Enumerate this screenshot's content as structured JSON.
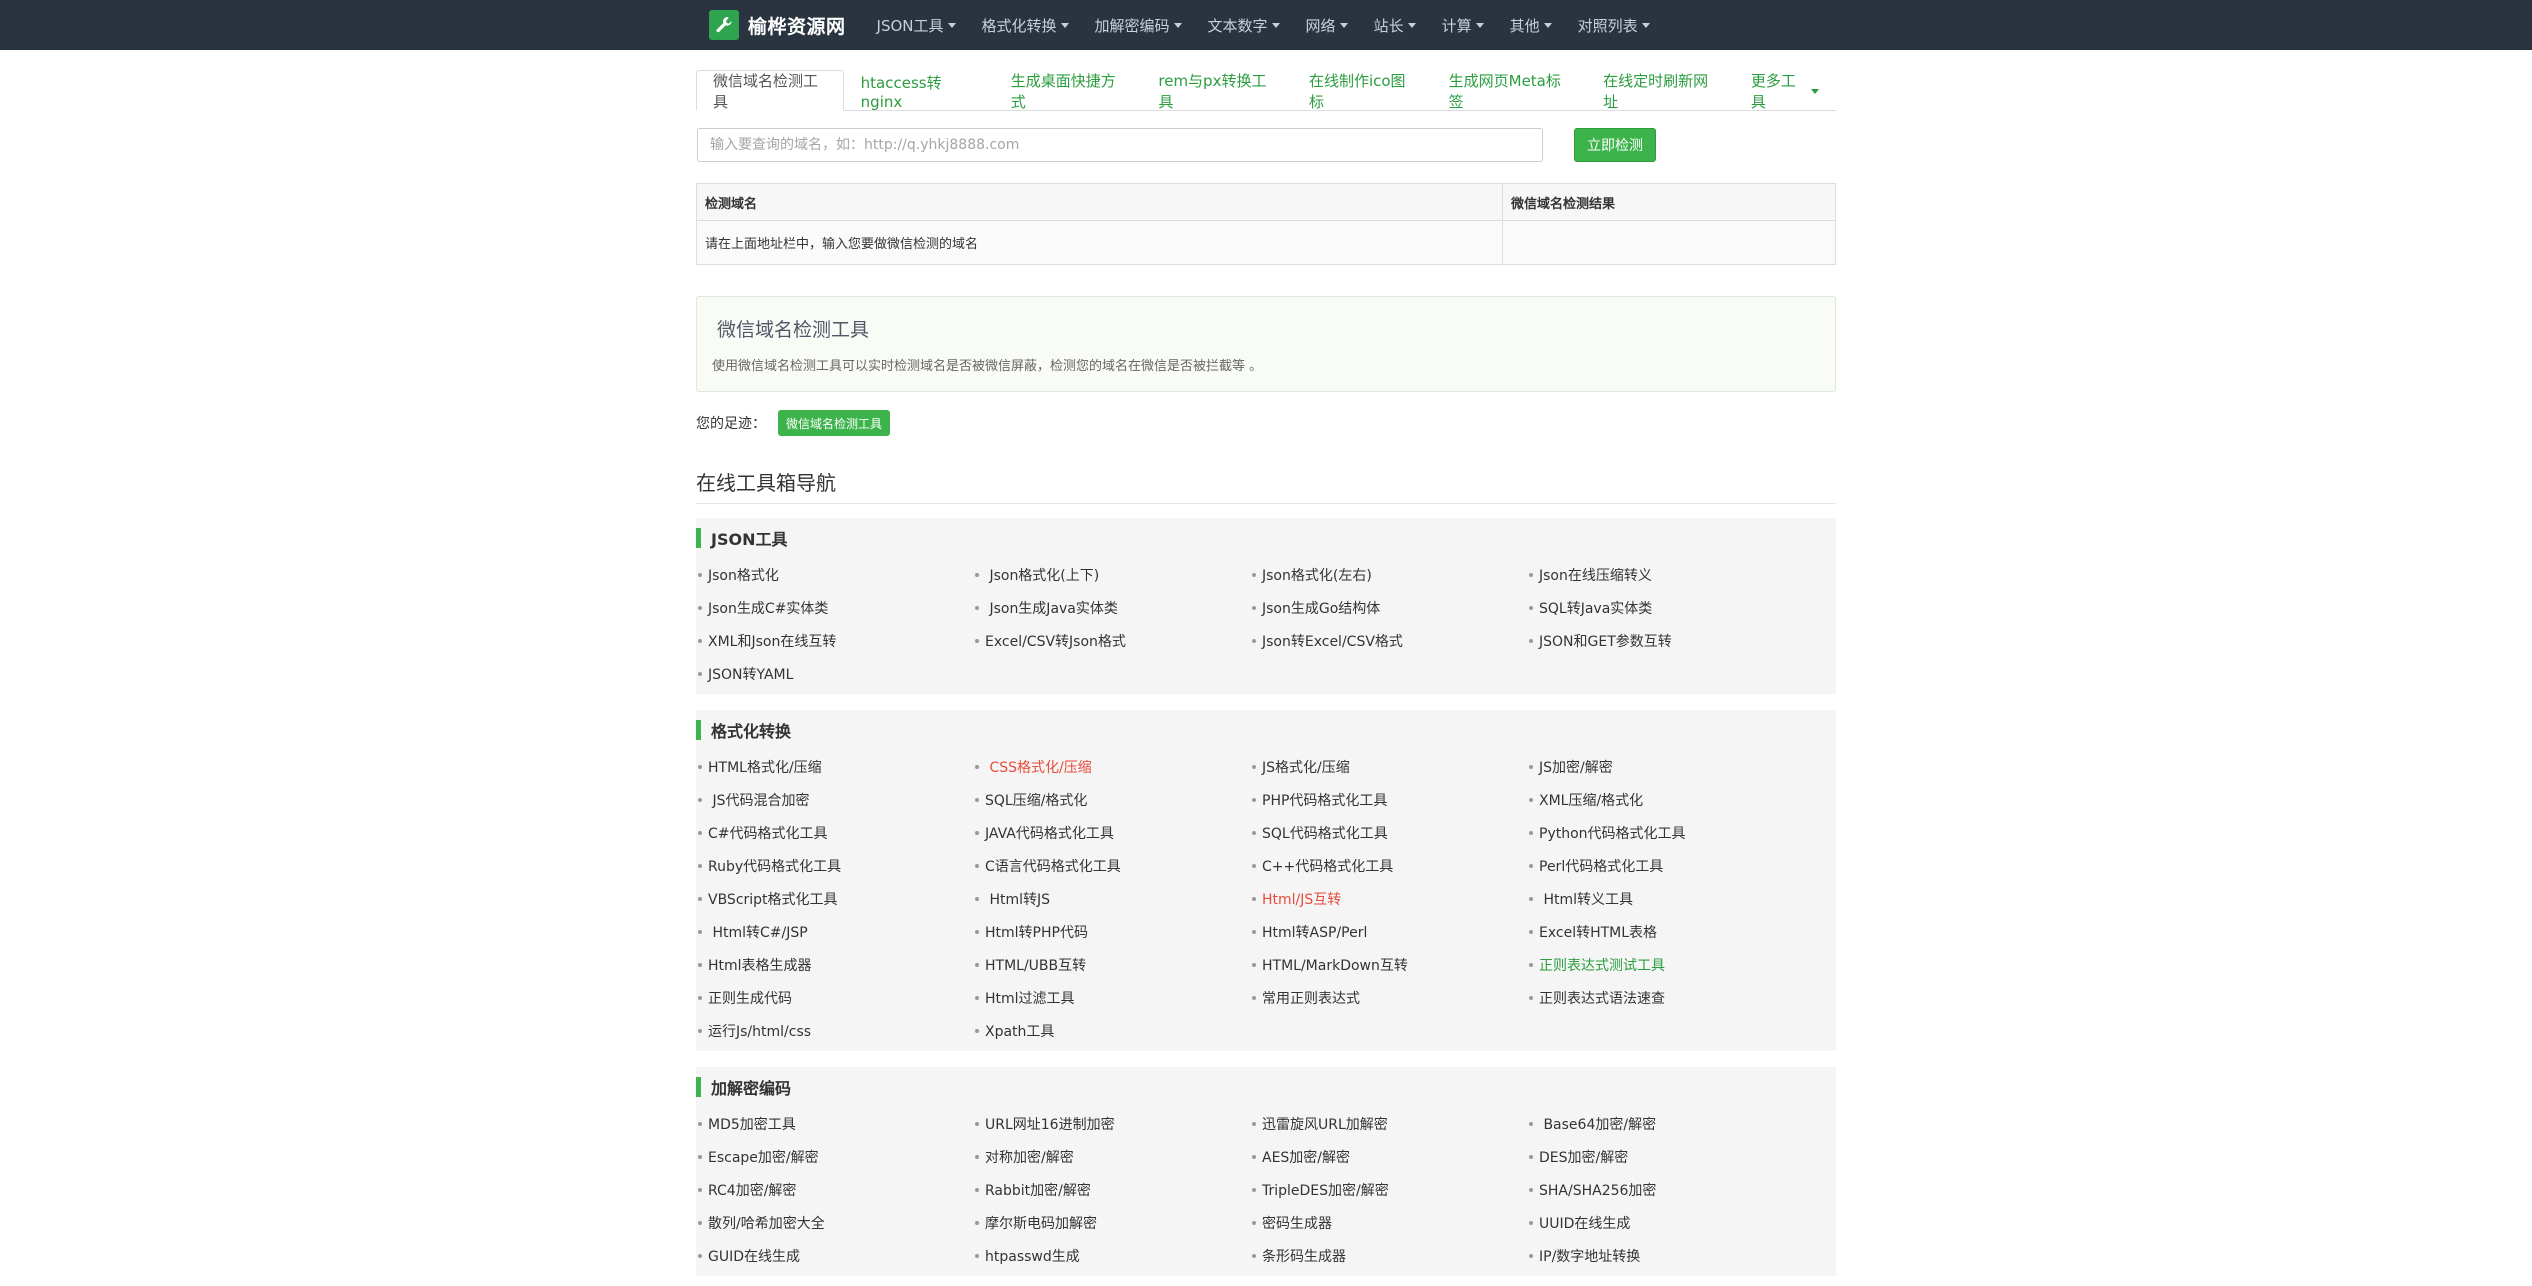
{
  "brand": {
    "name": "榆桦资源网"
  },
  "nav": [
    {
      "label": "JSON工具"
    },
    {
      "label": "格式化转换"
    },
    {
      "label": "加解密编码"
    },
    {
      "label": "文本数字"
    },
    {
      "label": "网络"
    },
    {
      "label": "站长"
    },
    {
      "label": "计算"
    },
    {
      "label": "其他"
    },
    {
      "label": "对照列表"
    }
  ],
  "tabs": [
    {
      "label": "微信域名检测工具",
      "active": true
    },
    {
      "label": "htaccess转nginx"
    },
    {
      "label": "生成桌面快捷方式"
    },
    {
      "label": "rem与px转换工具"
    },
    {
      "label": "在线制作ico图标"
    },
    {
      "label": "生成网页Meta标签"
    },
    {
      "label": "在线定时刷新网址"
    },
    {
      "label": "更多工具"
    }
  ],
  "search": {
    "placeholder": "输入要查询的域名，如：http://q.yhkj8888.com",
    "button": "立即检测"
  },
  "result_table": {
    "col1": "检测域名",
    "col2": "微信域名检测结果",
    "row_text": "请在上面地址栏中，输入您要做微信检测的域名"
  },
  "info": {
    "title": "微信域名检测工具",
    "desc": "使用微信域名检测工具可以实时检测域名是否被微信屏蔽，检测您的域名在微信是否被拦截等 。"
  },
  "footprint": {
    "label": "您的足迹：",
    "badge": "微信域名检测工具"
  },
  "nav_title": "在线工具箱导航",
  "categories": [
    {
      "name": "JSON工具",
      "items": [
        {
          "label": "Json格式化"
        },
        {
          "label": " Json格式化(上下)"
        },
        {
          "label": "Json格式化(左右)"
        },
        {
          "label": "Json在线压缩转义"
        },
        {
          "label": "Json生成C#实体类"
        },
        {
          "label": " Json生成Java实体类"
        },
        {
          "label": "Json生成Go结构体"
        },
        {
          "label": "SQL转Java实体类"
        },
        {
          "label": "XML和Json在线互转"
        },
        {
          "label": "Excel/CSV转Json格式"
        },
        {
          "label": "Json转Excel/CSV格式"
        },
        {
          "label": "JSON和GET参数互转"
        },
        {
          "label": "JSON转YAML"
        }
      ]
    },
    {
      "name": "格式化转换",
      "items": [
        {
          "label": "HTML格式化/压缩"
        },
        {
          "label": " CSS格式化/压缩",
          "color": "red"
        },
        {
          "label": "JS格式化/压缩"
        },
        {
          "label": "JS加密/解密"
        },
        {
          "label": " JS代码混合加密"
        },
        {
          "label": "SQL压缩/格式化"
        },
        {
          "label": "PHP代码格式化工具"
        },
        {
          "label": "XML压缩/格式化"
        },
        {
          "label": "C#代码格式化工具"
        },
        {
          "label": "JAVA代码格式化工具"
        },
        {
          "label": "SQL代码格式化工具"
        },
        {
          "label": "Python代码格式化工具"
        },
        {
          "label": "Ruby代码格式化工具"
        },
        {
          "label": "C语言代码格式化工具"
        },
        {
          "label": "C++代码格式化工具"
        },
        {
          "label": "Perl代码格式化工具"
        },
        {
          "label": "VBScript格式化工具"
        },
        {
          "label": " Html转JS"
        },
        {
          "label": "Html/JS互转",
          "color": "red"
        },
        {
          "label": " Html转义工具"
        },
        {
          "label": " Html转C#/JSP"
        },
        {
          "label": "Html转PHP代码"
        },
        {
          "label": "Html转ASP/Perl"
        },
        {
          "label": "Excel转HTML表格"
        },
        {
          "label": "Html表格生成器"
        },
        {
          "label": "HTML/UBB互转"
        },
        {
          "label": "HTML/MarkDown互转"
        },
        {
          "label": "正则表达式测试工具",
          "color": "green"
        },
        {
          "label": "正则生成代码"
        },
        {
          "label": "Html过滤工具"
        },
        {
          "label": "常用正则表达式"
        },
        {
          "label": "正则表达式语法速查"
        },
        {
          "label": "运行Js/html/css"
        },
        {
          "label": "Xpath工具"
        }
      ]
    },
    {
      "name": "加解密编码",
      "items": [
        {
          "label": "MD5加密工具"
        },
        {
          "label": "URL网址16进制加密"
        },
        {
          "label": "迅雷旋风URL加解密"
        },
        {
          "label": " Base64加密/解密"
        },
        {
          "label": "Escape加密/解密"
        },
        {
          "label": "对称加密/解密"
        },
        {
          "label": "AES加密/解密"
        },
        {
          "label": "DES加密/解密"
        },
        {
          "label": "RC4加密/解密"
        },
        {
          "label": "Rabbit加密/解密"
        },
        {
          "label": "TripleDES加密/解密"
        },
        {
          "label": "SHA/SHA256加密"
        },
        {
          "label": "散列/哈希加密大全"
        },
        {
          "label": "摩尔斯电码加解密"
        },
        {
          "label": "密码生成器"
        },
        {
          "label": "UUID在线生成"
        },
        {
          "label": "GUID在线生成"
        },
        {
          "label": "htpasswd生成"
        },
        {
          "label": "条形码生成器"
        },
        {
          "label": "IP/数字地址转换"
        }
      ]
    }
  ]
}
